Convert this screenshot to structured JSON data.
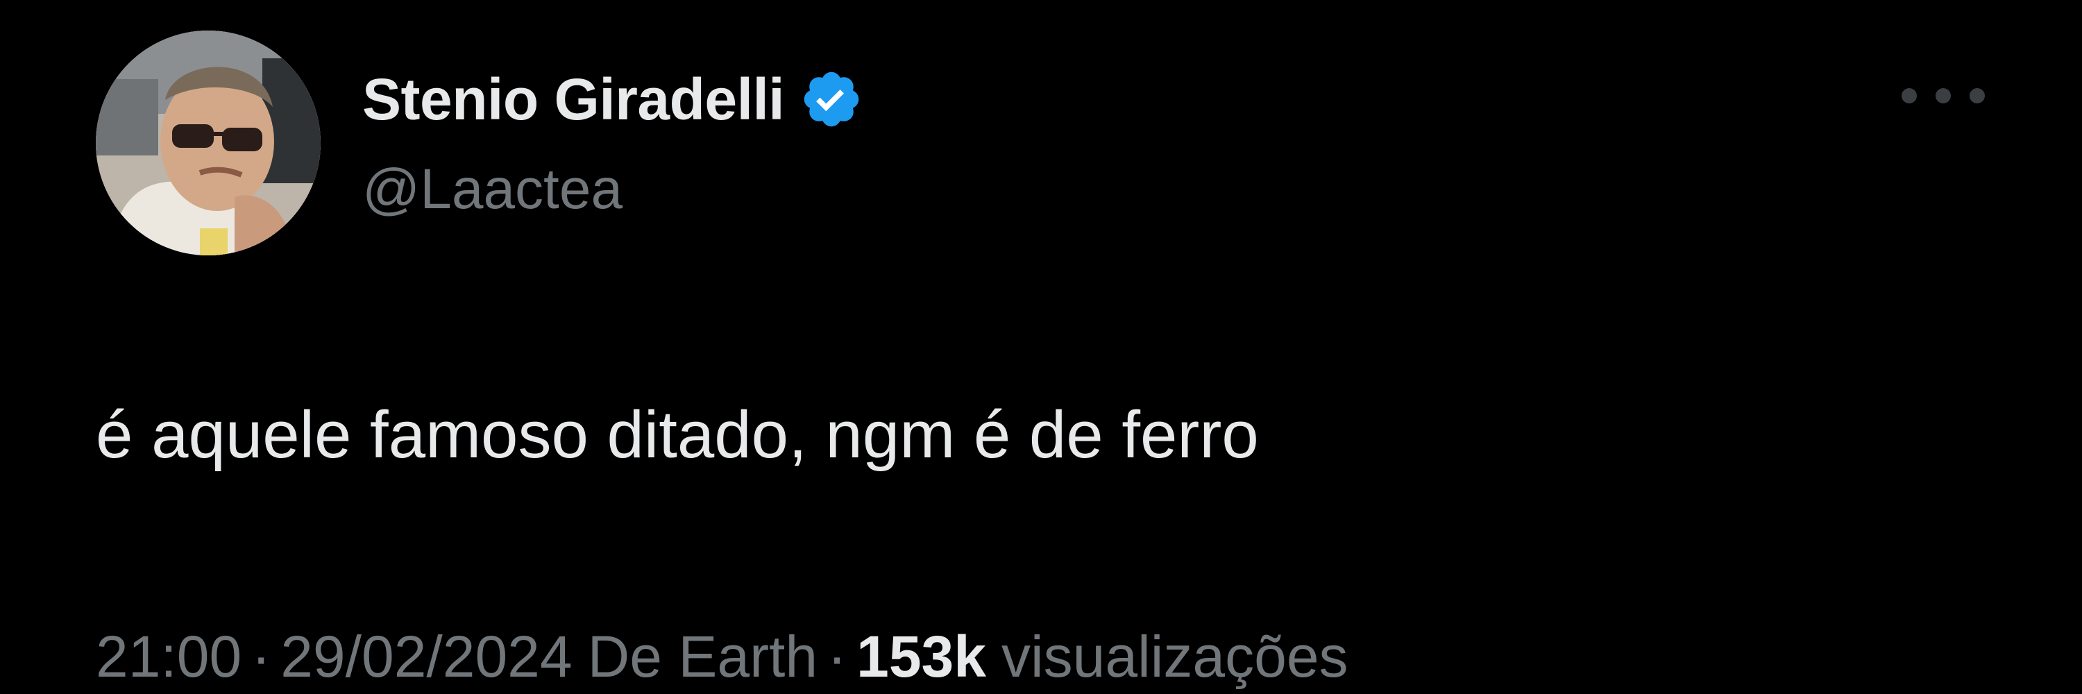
{
  "colors": {
    "background": "#000000",
    "primary_text": "#e7e9ea",
    "secondary_text": "#71767b",
    "verified_blue": "#1d9bf0"
  },
  "author": {
    "display_name": "Stenio Giradelli",
    "handle": "@Laactea",
    "verified": true,
    "verified_icon": "verified-badge-icon",
    "avatar_icon": "profile-photo"
  },
  "menu": {
    "icon": "more-options-icon"
  },
  "tweet": {
    "text": "é aquele famoso ditado, ngm é de ferro"
  },
  "meta": {
    "time": "21:00",
    "separator": "·",
    "date": "29/02/2024",
    "source": "De Earth",
    "views_count": "153k",
    "views_label": "visualizações"
  }
}
